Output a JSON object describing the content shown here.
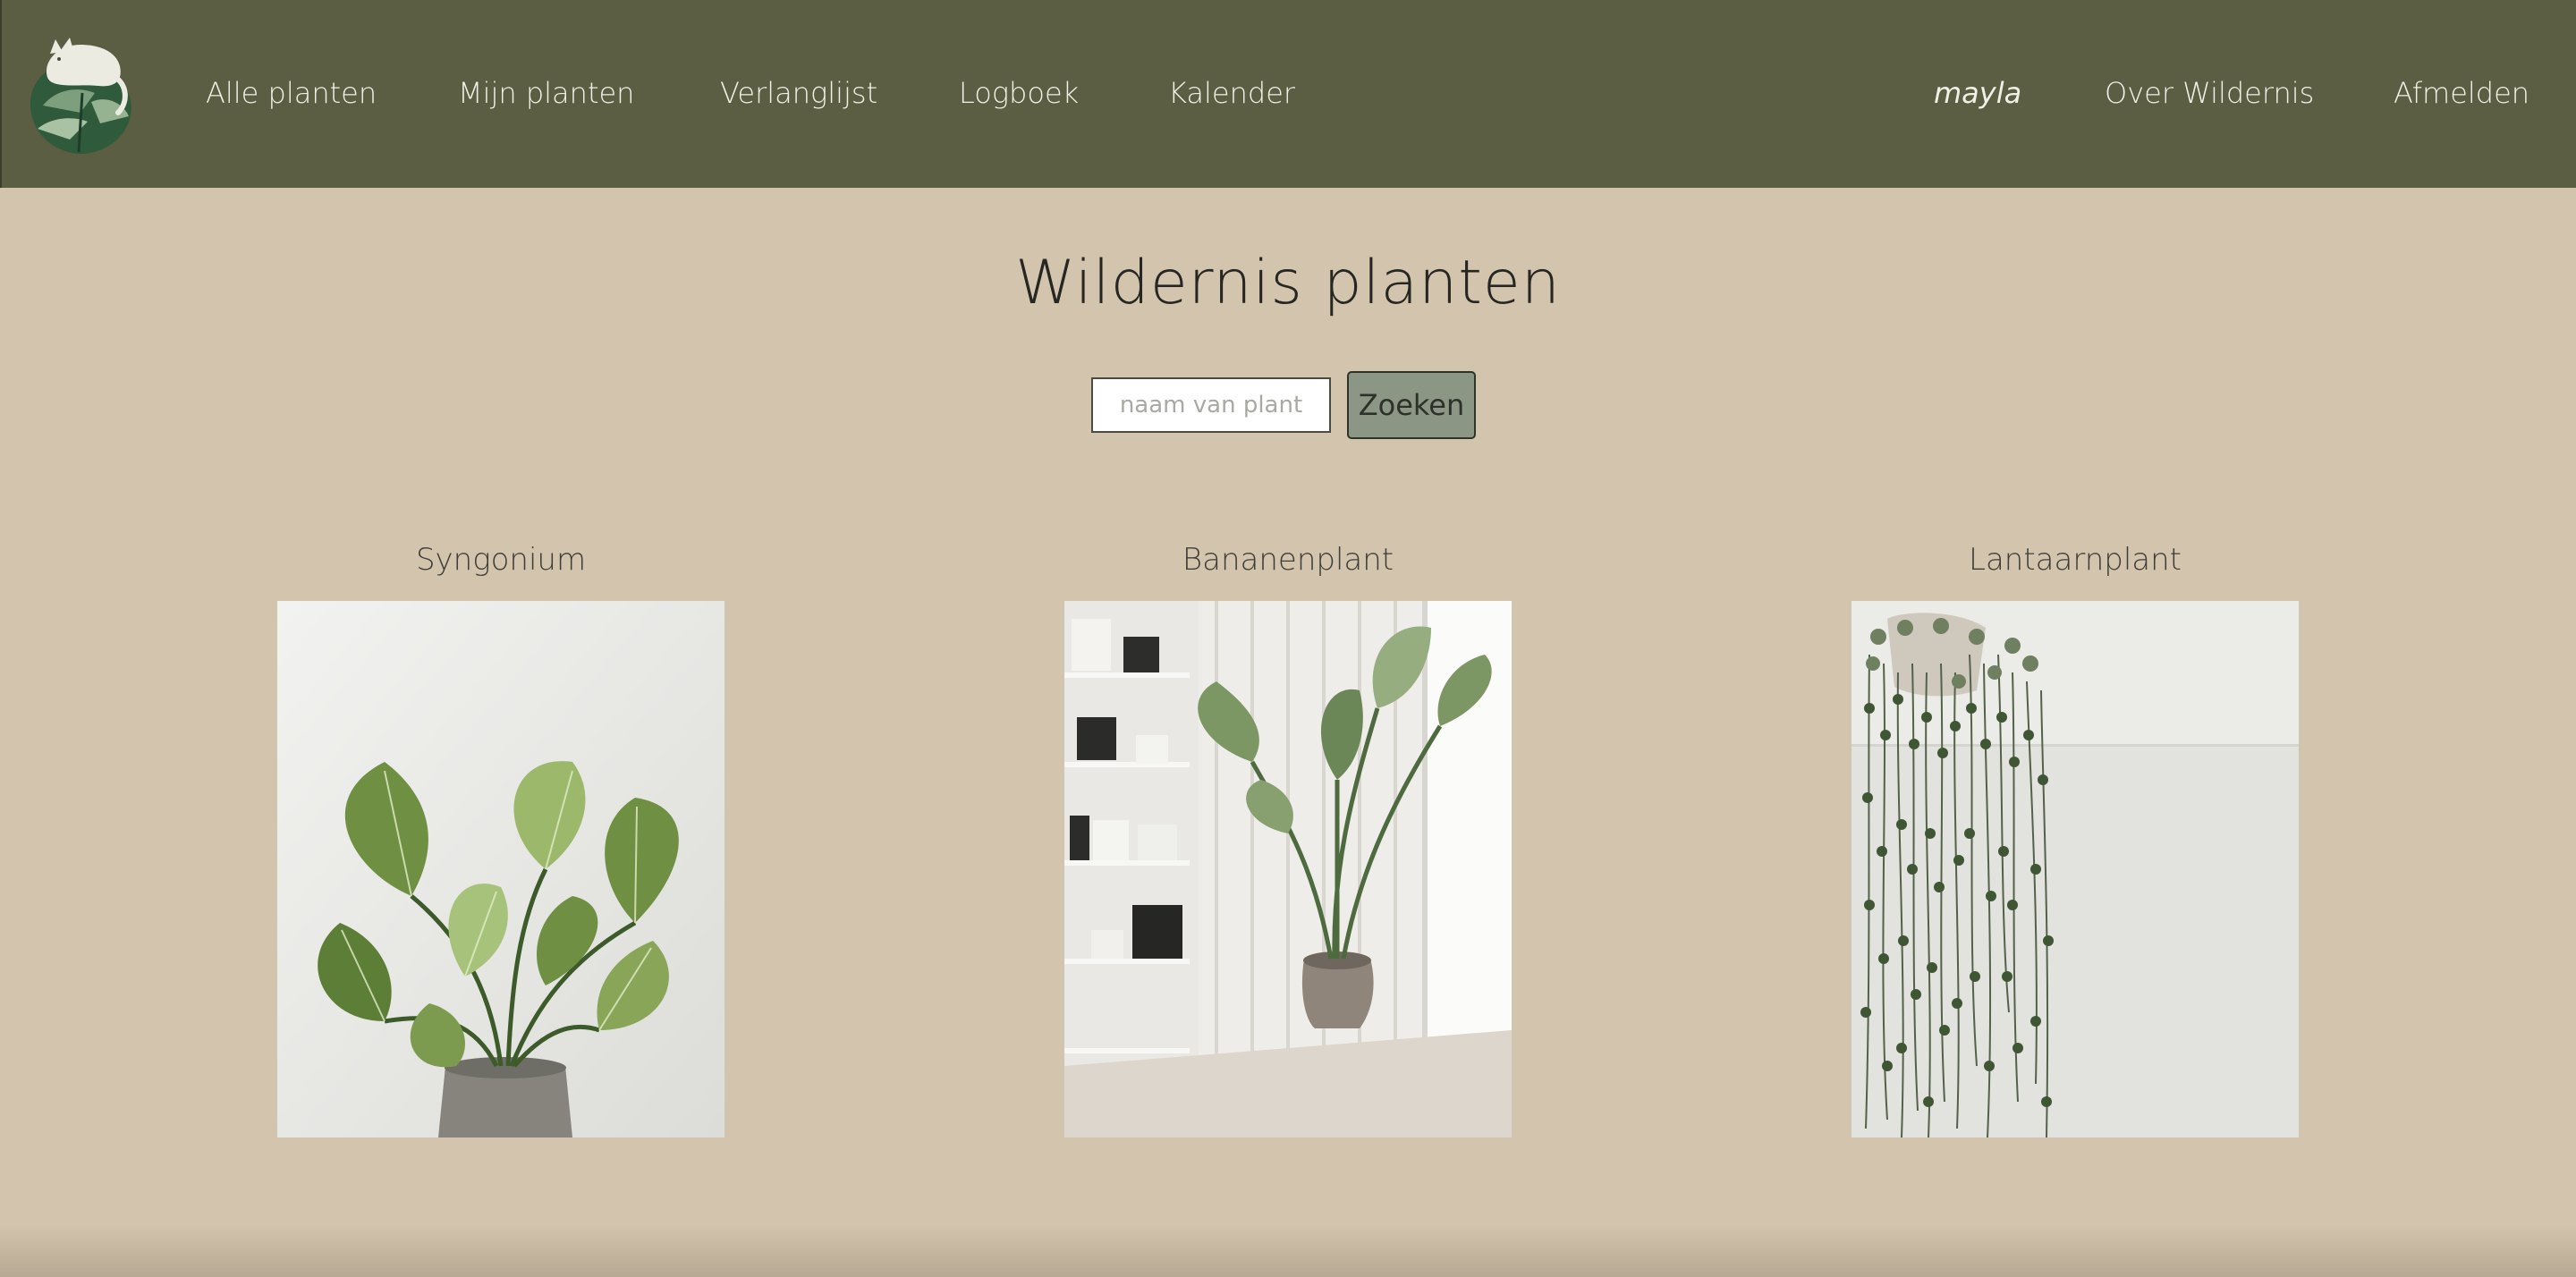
{
  "nav": {
    "logo_icon": "monstera-leaf-with-cat-logo",
    "left_items": [
      {
        "label": "Alle planten"
      },
      {
        "label": "Mijn planten"
      },
      {
        "label": "Verlanglijst"
      },
      {
        "label": "Logboek"
      },
      {
        "label": "Kalender"
      }
    ],
    "user": "mayla",
    "about": "Over Wildernis",
    "logout": "Afmelden"
  },
  "page": {
    "title": "Wildernis planten"
  },
  "search": {
    "placeholder": "naam van plant",
    "value": "",
    "button_label": "Zoeken"
  },
  "plants": [
    {
      "name": "Syngonium",
      "image_icon": "syngonium-plant-photo"
    },
    {
      "name": "Bananenplant",
      "image_icon": "banana-plant-photo"
    },
    {
      "name": "Lantaarnplant",
      "image_icon": "string-of-hearts-plant-photo"
    }
  ],
  "colors": {
    "navbar": "#5b5e43",
    "background": "#d3c4ad",
    "nav_text": "#f2efe6",
    "button": "#8b9684"
  }
}
